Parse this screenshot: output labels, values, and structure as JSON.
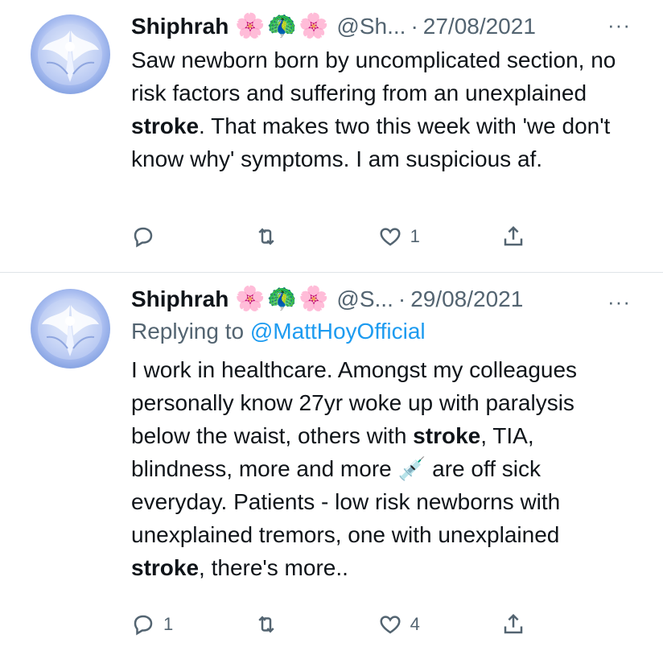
{
  "tweets": [
    {
      "author_name": "Shiphrah",
      "emoji": [
        "🌸",
        "🦚",
        "🌸"
      ],
      "handle": "@Sh...",
      "separator": "·",
      "date": "27/08/2021",
      "more_icon": "···",
      "replying_label": "",
      "replying_handle": "",
      "text_parts": [
        "Saw newborn born by uncomplicated section, no risk factors and suffering from an unexplained ",
        "stroke",
        ". That makes two this week with 'we don't know why' symptoms. I am suspicious af."
      ],
      "counts": {
        "reply": "",
        "retweet": "",
        "like": "1"
      },
      "icons": [
        "reply-icon",
        "retweet-icon",
        "like-icon",
        "share-icon"
      ]
    },
    {
      "author_name": "Shiphrah",
      "emoji": [
        "🌸",
        "🦚",
        "🌸"
      ],
      "handle": "@S...",
      "separator": "·",
      "date": "29/08/2021",
      "more_icon": "···",
      "replying_label": "Replying to ",
      "replying_handle": "@MattHoyOfficial",
      "text_parts": [
        "I work in healthcare. Amongst my colleagues personally know 27yr woke up with paralysis below the waist, others with ",
        "stroke",
        ", TIA, blindness, more and more 💉 are off sick everyday. Patients - low risk newborns with unexplained tremors, one with unexplained ",
        "stroke",
        ", there's more.."
      ],
      "counts": {
        "reply": "1",
        "retweet": "",
        "like": "4"
      },
      "icons": [
        "reply-icon",
        "retweet-icon",
        "like-icon",
        "share-icon"
      ]
    }
  ],
  "colors": {
    "text": "#0f1419",
    "secondary": "#536471",
    "link": "#1d9bf0",
    "divider": "#dfe4e8"
  }
}
